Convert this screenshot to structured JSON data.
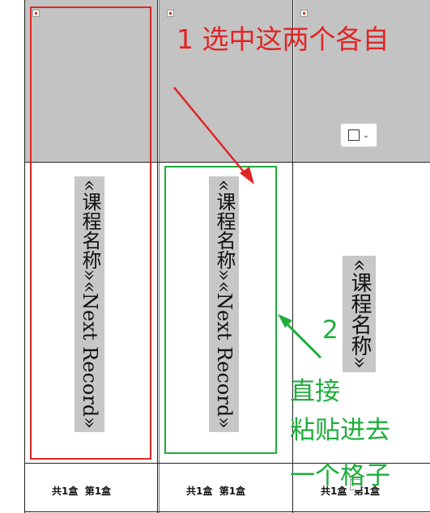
{
  "label_cells": [
    {
      "field_text": "«课程名称»«Next Record»",
      "footer": "共1盒  第1盒"
    },
    {
      "field_text": "«课程名称»«Next Record»",
      "footer": "共1盒  第1盒"
    },
    {
      "field_text": "«课程名称»",
      "footer": "共1盒  第1盒"
    }
  ],
  "annotations": {
    "step1": "1 选中这两个各自",
    "step2_number": "2",
    "step2_lines": [
      "直接",
      "粘贴进去",
      "一个格子"
    ]
  },
  "colors": {
    "annotation_red": "#e02525",
    "annotation_green": "#1fae3c",
    "image_placeholder": "#c3c3c3",
    "field_highlight": "#c7c7c7"
  },
  "icons": {
    "broken_image": "broken-image-icon",
    "layout_options": "layout-options-icon"
  }
}
